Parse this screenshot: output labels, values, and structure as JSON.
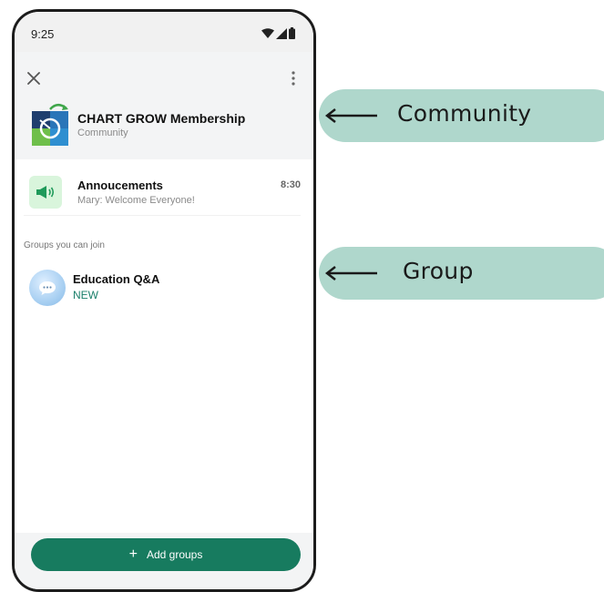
{
  "status_bar": {
    "time": "9:25",
    "icons": [
      "wifi-icon",
      "signal-icon",
      "battery-icon"
    ]
  },
  "toolbar": {
    "close_icon": "close-icon",
    "menu_icon": "more-vert-icon"
  },
  "community": {
    "name": "CHART GROW Membership",
    "subtitle": "Community"
  },
  "announcements": {
    "title": "Annoucements",
    "preview": "Mary: Welcome Everyone!",
    "time": "8:30",
    "icon": "megaphone-icon"
  },
  "groups_section": {
    "label": "Groups you can join",
    "items": [
      {
        "name": "Education Q&A",
        "badge": "NEW",
        "icon": "chat-bubble-icon"
      }
    ]
  },
  "add_groups_button": {
    "icon": "plus",
    "label": "Add groups"
  },
  "callouts": [
    {
      "label": "Community"
    },
    {
      "label": "Group"
    }
  ],
  "colors": {
    "accent": "#177b5f",
    "badge_text": "#1a7f6a",
    "callout_bg": "#afd7cc",
    "announcement_icon_bg": "#d9f5dc"
  }
}
